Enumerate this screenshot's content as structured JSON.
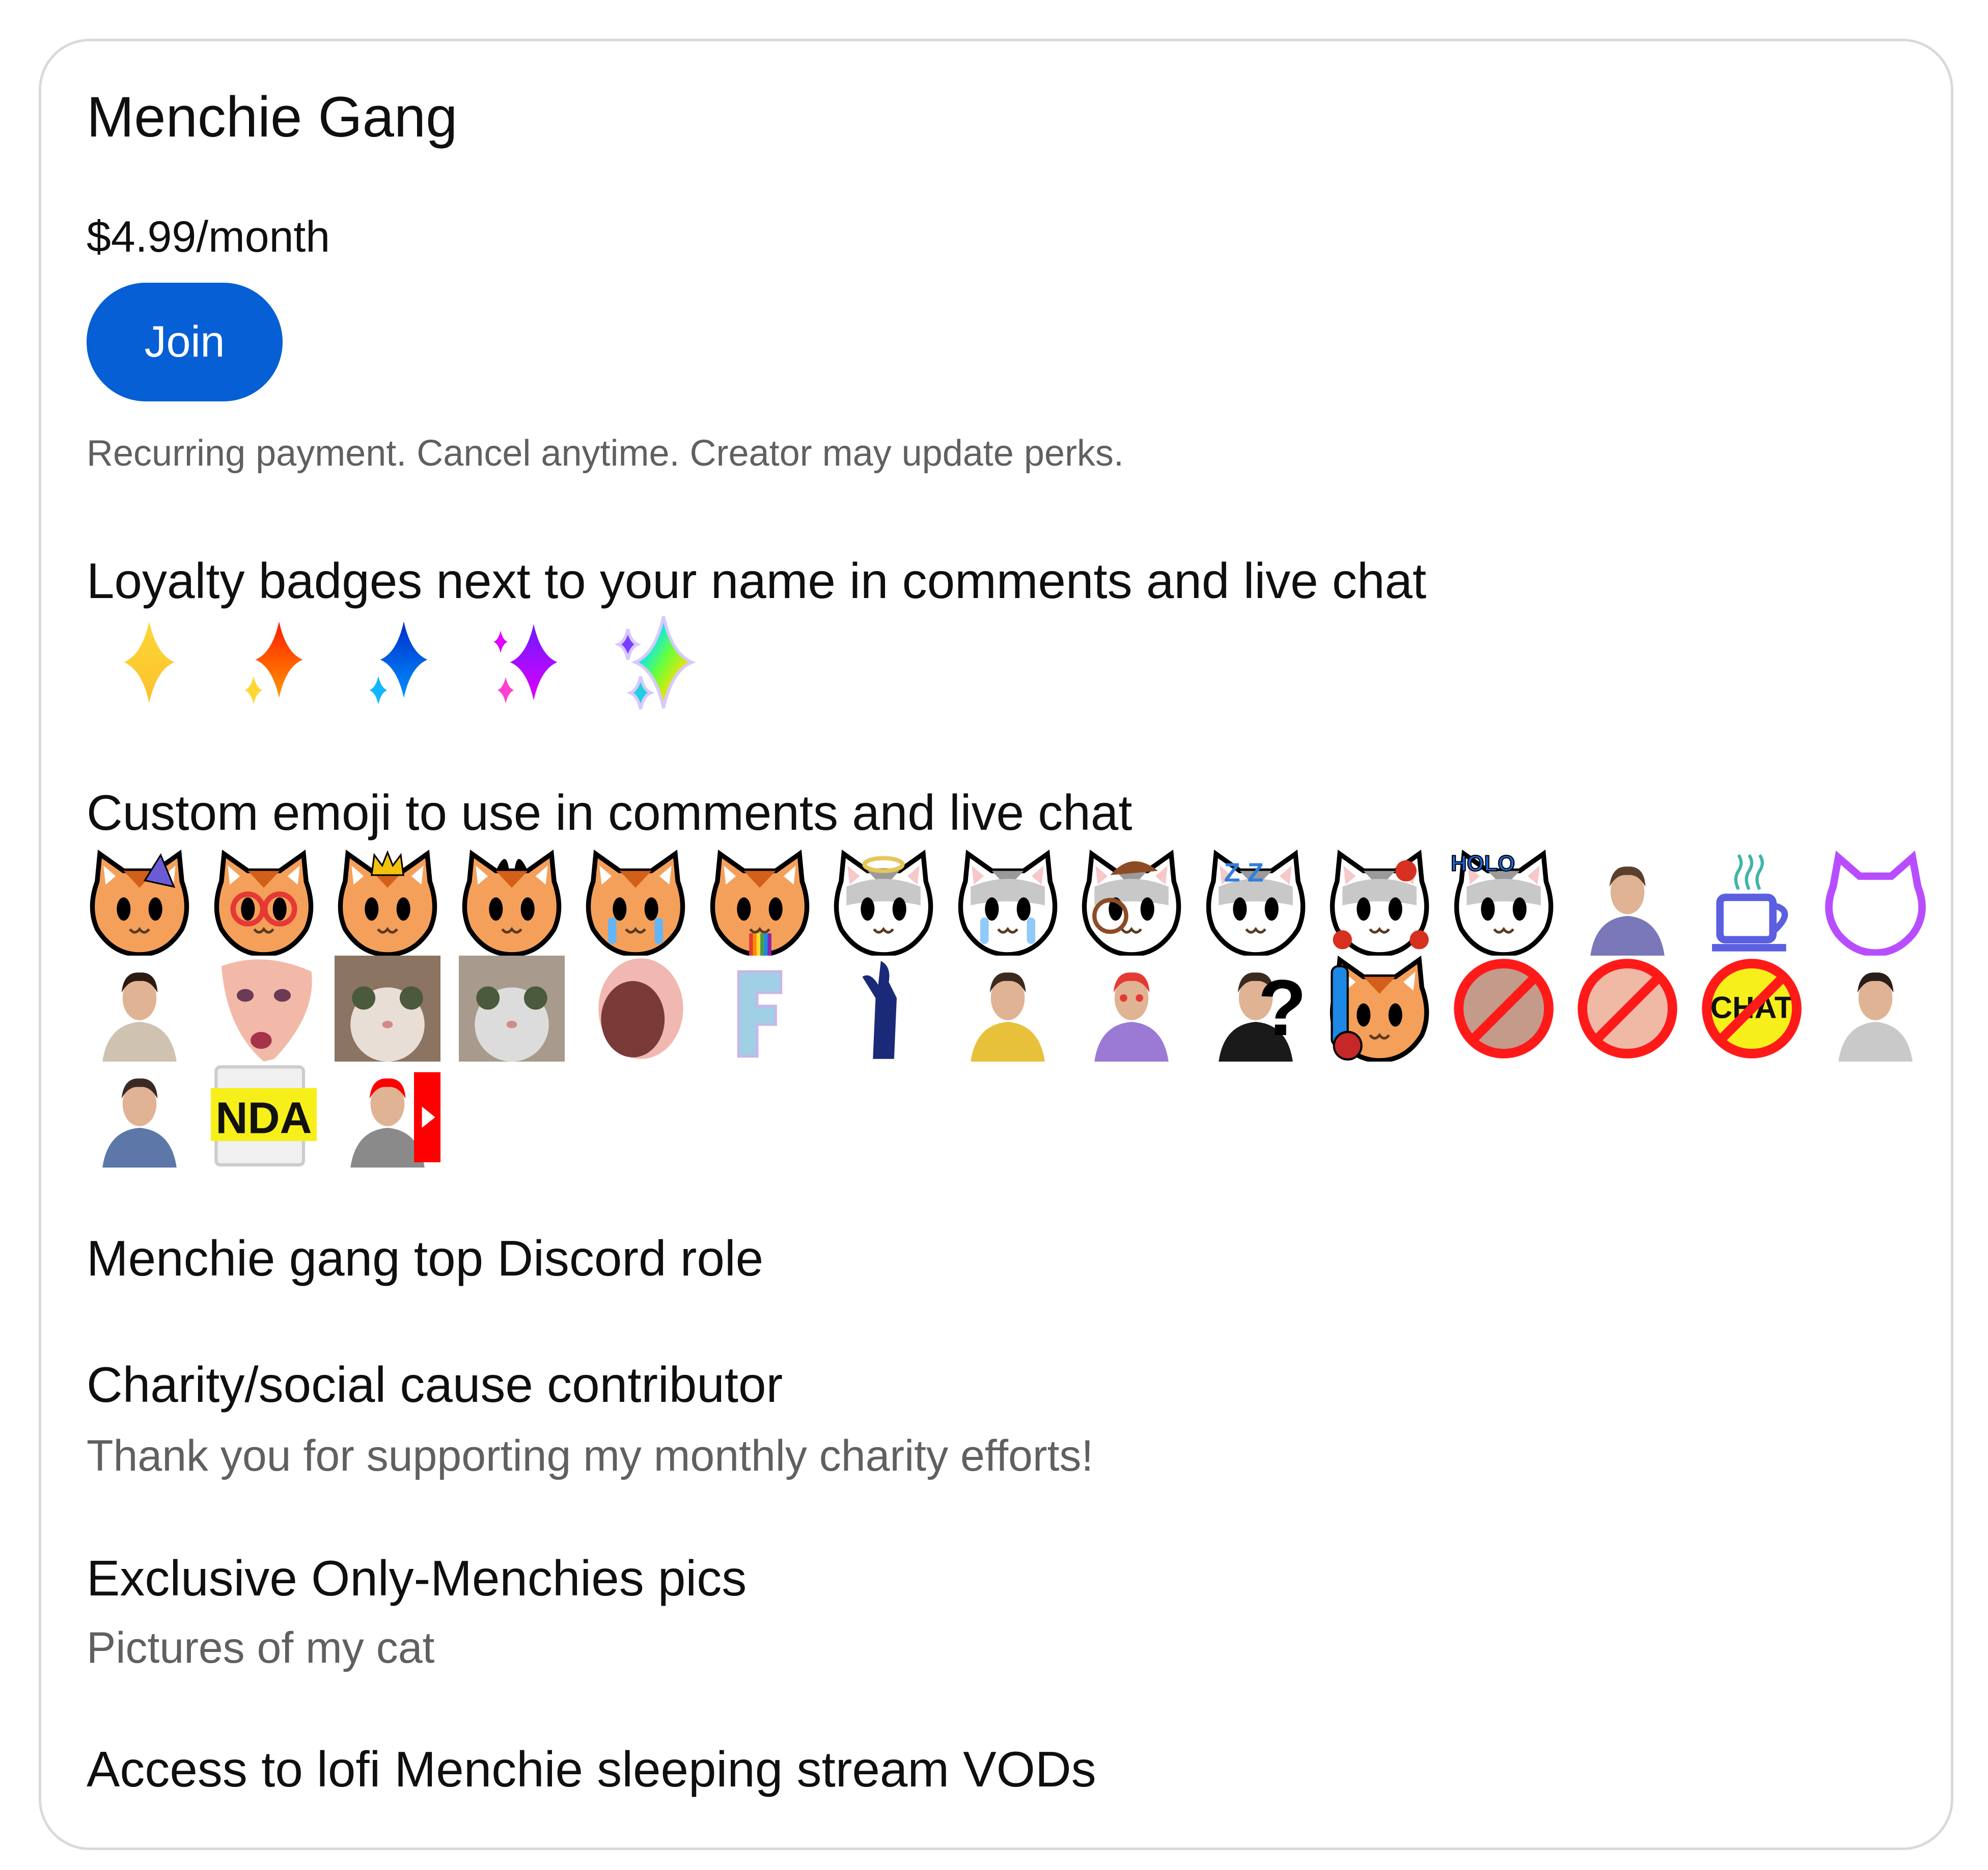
{
  "tier": {
    "name": "Menchie Gang",
    "price": "$4.99/month",
    "join_label": "Join",
    "fine_print": "Recurring payment. Cancel anytime. Creator may update perks.",
    "accent_color": "#065fd4"
  },
  "perks": {
    "badges": {
      "title": "Loyalty badges next to your name in comments and live chat",
      "items": [
        {
          "name": "badge-gold-sparkle",
          "color": "#fbc02d"
        },
        {
          "name": "badge-orange-sparkle",
          "color": "#ff5722"
        },
        {
          "name": "badge-blue-sparkle",
          "color": "#1e40ff"
        },
        {
          "name": "badge-purple-sparkle",
          "color": "#9c27ff"
        },
        {
          "name": "badge-rainbow-sparkle",
          "color": "#00c8ff"
        }
      ]
    },
    "emoji": {
      "title": "Custom emoji to use in comments and live chat",
      "items": [
        {
          "name": "orange-cat-party-emoji",
          "kind": "cat",
          "fur": "#f5a05a",
          "accent": "#6b5bd6"
        },
        {
          "name": "orange-cat-rainbow-eyes-emoji",
          "kind": "cat",
          "fur": "#f5a05a",
          "accent": "#e53935"
        },
        {
          "name": "orange-cat-crown-emoji",
          "kind": "cat",
          "fur": "#f5a05a",
          "accent": "#f4c20d"
        },
        {
          "name": "orange-cat-devil-emoji",
          "kind": "cat",
          "fur": "#f5a05a",
          "accent": "#000000"
        },
        {
          "name": "orange-cat-laugh-cry-emoji",
          "kind": "cat",
          "fur": "#f5a05a",
          "accent": "#64b5f6"
        },
        {
          "name": "orange-cat-rainbow-puke-emoji",
          "kind": "cat",
          "fur": "#f5a05a",
          "accent": "#43a047"
        },
        {
          "name": "gray-cat-halo-emoji",
          "kind": "cat",
          "fur": "#c8c8c8",
          "accent": "#e6c65a"
        },
        {
          "name": "gray-cat-crying-emoji",
          "kind": "cat",
          "fur": "#c8c8c8",
          "accent": "#90caf9"
        },
        {
          "name": "gray-cat-detective-emoji",
          "kind": "cat",
          "fur": "#c8c8c8",
          "accent": "#8d4b24"
        },
        {
          "name": "gray-cat-sleeping-emoji",
          "kind": "cat",
          "fur": "#c8c8c8",
          "accent": "#2f7de1"
        },
        {
          "name": "gray-cat-hearts-emoji",
          "kind": "cat",
          "fur": "#c8c8c8",
          "accent": "#d83020"
        },
        {
          "name": "gray-cat-holo-emoji",
          "kind": "cat",
          "fur": "#c8c8c8",
          "accent": "#1e63d6"
        },
        {
          "name": "woman-purple-shirt-emoji",
          "kind": "person",
          "fur": "#7a78b8",
          "accent": "#5a3f2c"
        },
        {
          "name": "neon-coffee-cup-emoji",
          "kind": "cup",
          "fur": "#5b5fe0",
          "accent": "#3fb5a8"
        },
        {
          "name": "neon-cat-outline-emoji",
          "kind": "neoncat",
          "fur": "#b84dff",
          "accent": "#b84dff"
        },
        {
          "name": "person-tied-rope-emoji",
          "kind": "person",
          "fur": "#cfc2b0",
          "accent": "#2b1a12"
        },
        {
          "name": "shocked-woman-face-emoji",
          "kind": "face",
          "fur": "#f2b9a9",
          "accent": "#a6334a"
        },
        {
          "name": "blurry-cat-scream-emoji",
          "kind": "photo",
          "fur": "#8b7462",
          "accent": "#e9ded6"
        },
        {
          "name": "wide-eyed-cat-emoji",
          "kind": "photo",
          "fur": "#a89a8c",
          "accent": "#dcdcdc"
        },
        {
          "name": "screaming-mouth-emoji",
          "kind": "mouth",
          "fur": "#f0b8b0",
          "accent": "#7a3a38"
        },
        {
          "name": "holographic-letter-f-emoji",
          "kind": "letter",
          "fur": "#9fd0e6",
          "accent": "#c9b6e6"
        },
        {
          "name": "blue-silhouette-emoji",
          "kind": "silhouette",
          "fur": "#1a2a78",
          "accent": "#1a2a78"
        },
        {
          "name": "man-eating-banana-emoji",
          "kind": "person",
          "fur": "#e8c13a",
          "accent": "#3b2a20"
        },
        {
          "name": "man-heart-eyes-popcorn-emoji",
          "kind": "person",
          "fur": "#9b7ad6",
          "accent": "#e53935"
        },
        {
          "name": "man-question-mark-emoji",
          "kind": "person",
          "fur": "#1a1a1a",
          "accent": "#3b2a20"
        },
        {
          "name": "orange-cat-wrench-heart-emoji",
          "kind": "cat",
          "fur": "#f5a05a",
          "accent": "#1e88e5"
        },
        {
          "name": "no-man-face-emoji",
          "kind": "forbidden",
          "fur": "#c49a8a",
          "accent": "#ff1a1a"
        },
        {
          "name": "no-woman-face-emoji",
          "kind": "forbidden",
          "fur": "#f0b9a6",
          "accent": "#ff1a1a"
        },
        {
          "name": "no-chat-emoji",
          "kind": "forbidden",
          "fur": "#f7ef1a",
          "accent": "#ff1a1a"
        },
        {
          "name": "woman-smiling-emoji",
          "kind": "person",
          "fur": "#c9c9c9",
          "accent": "#2a1d1a"
        },
        {
          "name": "woman-blue-hood-emoji",
          "kind": "person",
          "fur": "#5c77a8",
          "accent": "#3a2a24"
        },
        {
          "name": "nda-sign-emoji",
          "kind": "nda",
          "fur": "#f7ef1a",
          "accent": "#111111"
        },
        {
          "name": "woman-youtube-logo-emoji",
          "kind": "person",
          "fur": "#8a8a8a",
          "accent": "#ff0000"
        }
      ]
    },
    "list": [
      {
        "title": "Menchie gang top Discord role",
        "subtitle": ""
      },
      {
        "title": "Charity/social cause contributor",
        "subtitle": "Thank you for supporting my monthly charity efforts!"
      },
      {
        "title": "Exclusive Only-Menchies pics",
        "subtitle": "Pictures of my cat"
      },
      {
        "title": "Access to lofi Menchie sleeping stream VODs",
        "subtitle": ""
      }
    ],
    "emoji_label_nda": "NDA",
    "emoji_label_chat": "CHAT",
    "emoji_label_holo": "HOLO"
  }
}
